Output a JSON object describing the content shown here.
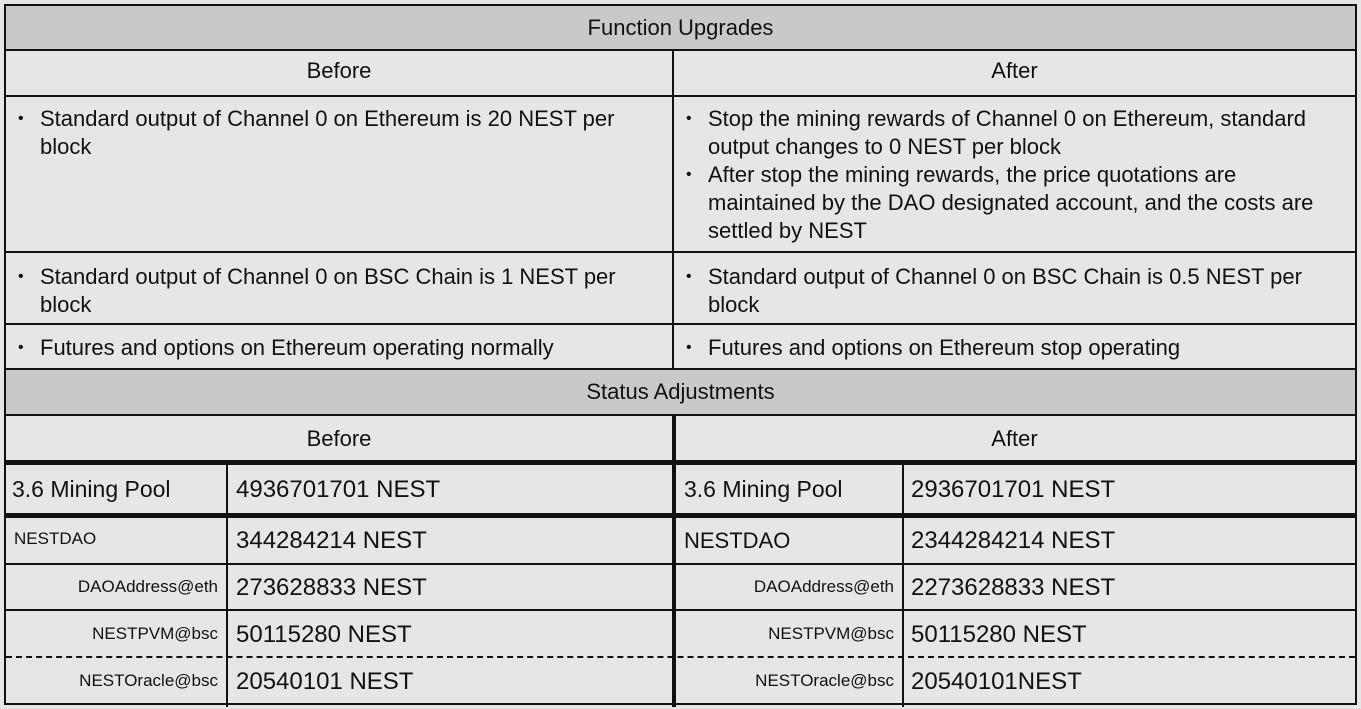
{
  "function_upgrades": {
    "title": "Function Upgrades",
    "before_label": "Before",
    "after_label": "After",
    "rows": [
      {
        "before": [
          "Standard output of Channel 0 on Ethereum is 20 NEST per block"
        ],
        "after": [
          "Stop the mining rewards of Channel 0 on Ethereum, standard output changes to 0 NEST per block",
          "After stop the mining rewards, the price quotations are maintained by the DAO designated account, and the costs are settled by NEST"
        ]
      },
      {
        "before": [
          "Standard output of Channel 0 on BSC Chain is 1 NEST per block"
        ],
        "after": [
          "Standard output of Channel 0 on BSC Chain is 0.5 NEST per block"
        ]
      },
      {
        "before": [
          "Futures and options on Ethereum operating normally"
        ],
        "after": [
          "Futures and options on Ethereum stop operating"
        ]
      }
    ]
  },
  "status_adjustments": {
    "title": "Status Adjustments",
    "before_label": "Before",
    "after_label": "After",
    "before": {
      "mining_pool_label": "3.6 Mining Pool",
      "mining_pool_value": "4936701701 NEST",
      "nestdao_label": "NESTDAO",
      "nestdao_value": "344284214 NEST",
      "dao_address_label": "DAOAddress@eth",
      "dao_address_value": "273628833 NEST",
      "nestpvm_label": "NESTPVM@bsc",
      "nestpvm_value": "50115280 NEST",
      "nestoracle_label": "NESTOracle@bsc",
      "nestoracle_value": "20540101 NEST"
    },
    "after": {
      "mining_pool_label": "3.6 Mining Pool",
      "mining_pool_value": "2936701701 NEST",
      "nestdao_label": "NESTDAO",
      "nestdao_value": "2344284214 NEST",
      "dao_address_label": "DAOAddress@eth",
      "dao_address_value": "2273628833 NEST",
      "nestpvm_label": "NESTPVM@bsc",
      "nestpvm_value": "50115280 NEST",
      "nestoracle_label": "NESTOracle@bsc",
      "nestoracle_value": "20540101NEST"
    }
  }
}
